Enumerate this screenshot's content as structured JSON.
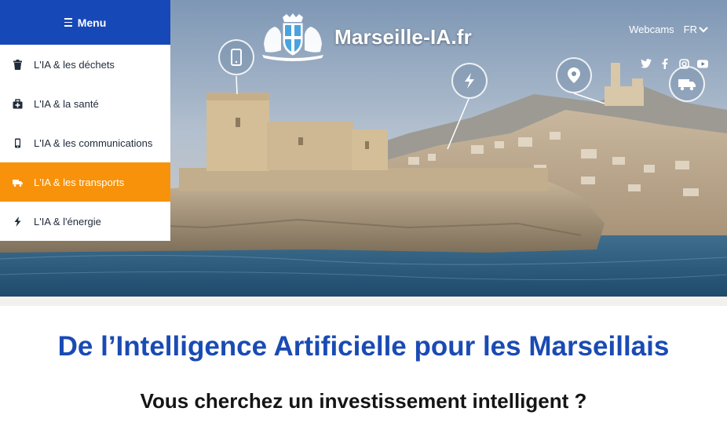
{
  "header": {
    "menu_label": "Menu",
    "site_title": "Marseille-IA.fr",
    "webcams_label": "Webcams",
    "language": "FR"
  },
  "menu": {
    "items": [
      {
        "label": "L'IA & les déchets",
        "icon": "trash-icon",
        "active": false
      },
      {
        "label": "L'IA & la santé",
        "icon": "medical-bag-icon",
        "active": false
      },
      {
        "label": "L'IA & les communications",
        "icon": "mobile-phone-icon",
        "active": false
      },
      {
        "label": "L'IA & les transports",
        "icon": "truck-icon",
        "active": true
      },
      {
        "label": "L'IA & l'énergie",
        "icon": "lightning-icon",
        "active": false
      }
    ]
  },
  "social": [
    "twitter-icon",
    "facebook-icon",
    "instagram-icon",
    "youtube-icon"
  ],
  "hero_bubbles": [
    "mobile-phone-icon",
    "lightning-icon",
    "location-pin-icon",
    "truck-icon"
  ],
  "content": {
    "heading": "De l’Intelligence Artificielle pour les Marseillais",
    "subheading": "Vous cherchez un investissement intelligent ?"
  },
  "colors": {
    "menu_blue": "#1748b8",
    "active_orange": "#f7920a",
    "heading_blue": "#1a4bb4"
  }
}
